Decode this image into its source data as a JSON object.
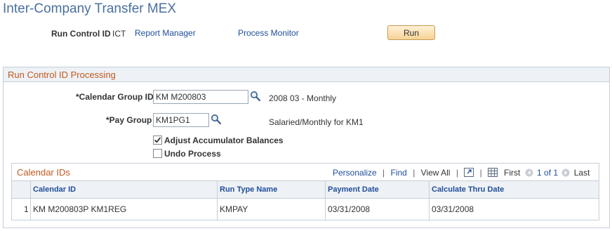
{
  "page": {
    "title": "Inter-Company Transfer MEX"
  },
  "header": {
    "run_control_label": "Run Control ID",
    "run_control_value": "ICT",
    "report_manager": "Report Manager",
    "process_monitor": "Process Monitor",
    "run_button": "Run"
  },
  "processing": {
    "section_title": "Run Control ID Processing",
    "calendar_group_label": "*Calendar Group ID",
    "calendar_group_value": "KM M200803",
    "calendar_group_desc": "2008 03 - Monthly",
    "pay_group_label": "*Pay Group",
    "pay_group_value": "KM1PG1",
    "pay_group_desc": "Salaried/Monthly for KM1",
    "adjust_label": "Adjust Accumulator Balances",
    "adjust_checked": true,
    "undo_label": "Undo Process",
    "undo_checked": false
  },
  "grid": {
    "title": "Calendar IDs",
    "personalize": "Personalize",
    "separator": "|",
    "find": "Find",
    "view_all": "View All",
    "first": "First",
    "range": "1 of 1",
    "last": "Last",
    "columns": [
      "Calendar ID",
      "Run Type Name",
      "Payment Date",
      "Calculate Thru Date"
    ],
    "rows": [
      {
        "num": "1",
        "calendar_id": "KM M200803P KM1REG",
        "run_type_name": "KMPAY",
        "payment_date": "03/31/2008",
        "calculate_thru_date": "03/31/2008"
      }
    ]
  }
}
